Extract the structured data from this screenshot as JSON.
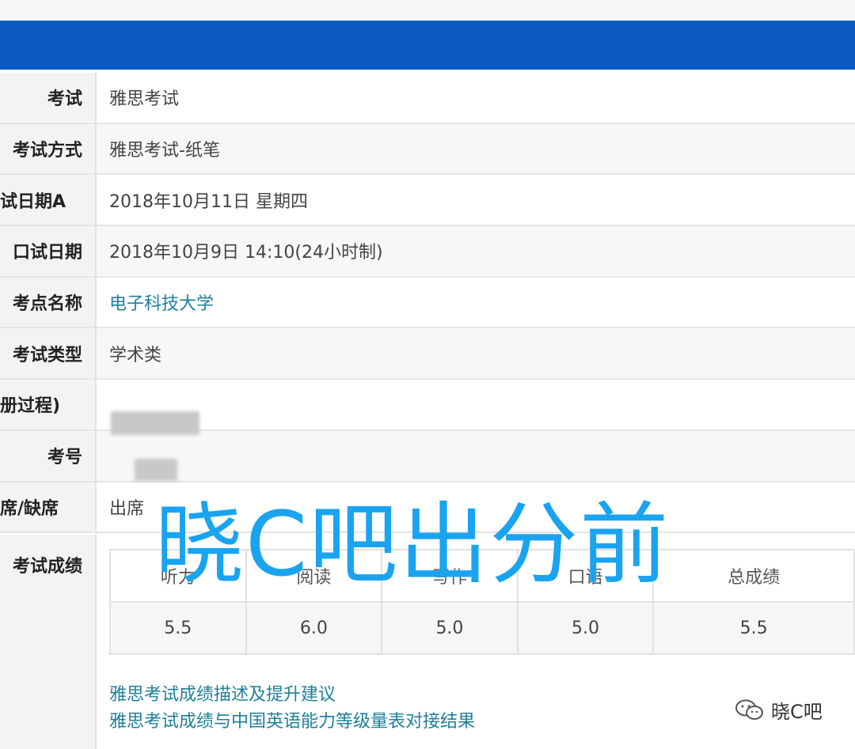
{
  "rows": [
    {
      "label": "考试",
      "value": "雅思考试"
    },
    {
      "label": "考试方式",
      "value": "雅思考试-纸笔"
    },
    {
      "label": "笔试日期A",
      "value": "2018年10月11日 星期四"
    },
    {
      "label": "口试日期",
      "value": "2018年10月9日 14:10(24小时制)"
    },
    {
      "label": "考点名称",
      "value": "电子科技大学"
    },
    {
      "label": "考试类型",
      "value": "学术类"
    },
    {
      "label": "注册过程)",
      "value": ""
    },
    {
      "label": "考号",
      "value": ""
    },
    {
      "label": "出席/缺席",
      "value": "出席"
    }
  ],
  "scores": {
    "label": "考试成绩",
    "headers": [
      "听力",
      "阅读",
      "写作",
      "口语",
      "总成绩"
    ],
    "values": [
      "5.5",
      "6.0",
      "5.0",
      "5.0",
      "5.5"
    ]
  },
  "links": [
    "雅思考试成绩描述及提升建议",
    "雅思考试成绩与中国英语能力等级量表对接结果"
  ],
  "watermark": "晓C吧出分前",
  "brand": {
    "text": "晓C吧",
    "icon": "wechat-icon"
  },
  "colors": {
    "header": "#0b5bc2",
    "link": "#1f7f9a",
    "watermark": "#1aa4f0"
  }
}
